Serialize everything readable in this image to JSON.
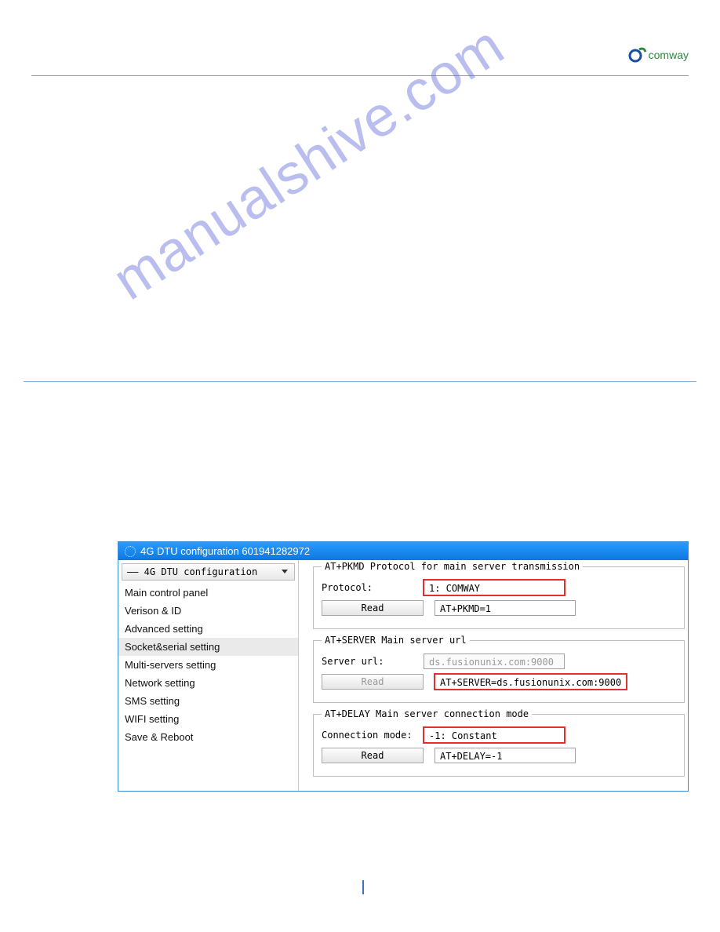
{
  "brand": "comway",
  "watermark": "manualshive.com",
  "window": {
    "title": "4G DTU configuration 601941282972"
  },
  "sidebar": {
    "header": "—— 4G DTU configuration",
    "items": [
      "Main control panel",
      "Verison & ID",
      "Advanced setting",
      "Socket&serial setting",
      "Multi-servers setting",
      "Network setting",
      "SMS setting",
      "WIFI setting",
      "Save & Reboot"
    ],
    "selected_index": 3
  },
  "groups": [
    {
      "title": "AT+PKMD Protocol for main server transmission",
      "label": "Protocol:",
      "value": "1: COMWAY",
      "value_highlight": true,
      "value_disabled": false,
      "button": "Read",
      "button_disabled": false,
      "result": "AT+PKMD=1",
      "result_highlight": false
    },
    {
      "title": "AT+SERVER Main server url",
      "label": "Server url:",
      "value": "ds.fusionunix.com:9000",
      "value_highlight": false,
      "value_disabled": true,
      "button": "Read",
      "button_disabled": true,
      "result": "AT+SERVER=ds.fusionunix.com:9000",
      "result_highlight": true
    },
    {
      "title": "AT+DELAY Main server connection mode",
      "label": "Connection mode:",
      "value": "-1: Constant",
      "value_highlight": true,
      "value_disabled": false,
      "button": "Read",
      "button_disabled": false,
      "result": "AT+DELAY=-1",
      "result_highlight": false
    }
  ],
  "page_number": ""
}
